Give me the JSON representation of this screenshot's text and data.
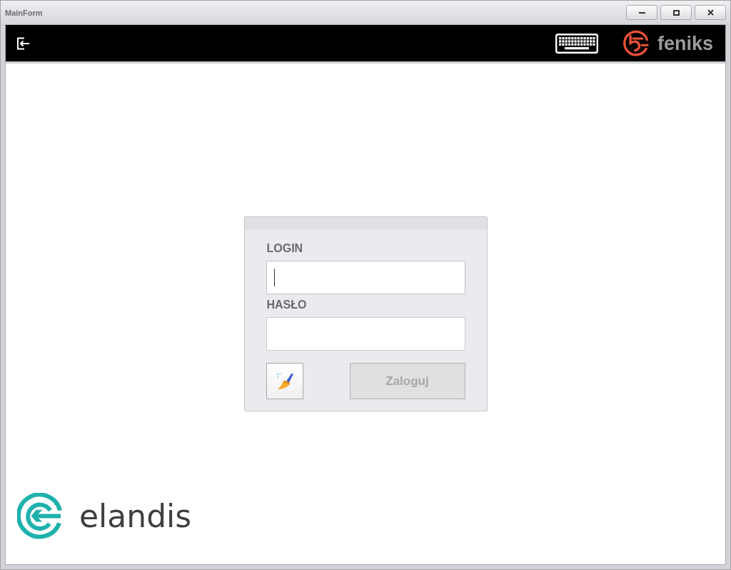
{
  "window": {
    "title": "MainForm"
  },
  "toolbar": {
    "brand": "feniks"
  },
  "login_panel": {
    "fields": [
      {
        "label": "LOGIN",
        "focused": true
      },
      {
        "label": "HASŁO",
        "focused": false
      }
    ],
    "login_button": {
      "label": "Zaloguj",
      "disabled": true
    }
  },
  "footer": {
    "brand": "elandis"
  }
}
